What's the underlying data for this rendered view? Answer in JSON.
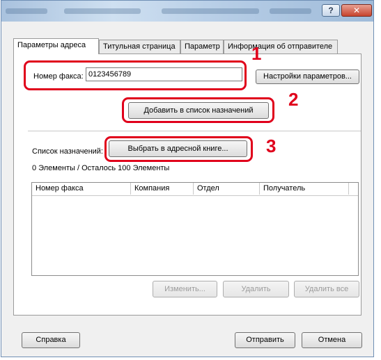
{
  "window": {
    "help_glyph": "?",
    "close_glyph": "✕"
  },
  "tabs": [
    {
      "label": "Параметры адреса"
    },
    {
      "label": "Титульная страница"
    },
    {
      "label": "Параметр"
    },
    {
      "label": "Информация об отправителе"
    }
  ],
  "fax": {
    "label": "Номер факса:",
    "value": "0123456789",
    "settings_button": "Настройки параметров..."
  },
  "add_button": "Добавить в список назначений",
  "destinations": {
    "label": "Список назначений:",
    "address_book_button": "Выбрать в адресной книге...",
    "count_text": "0 Элементы / Осталось 100 Элементы",
    "columns": [
      "Номер факса",
      "Компания",
      "Отдел",
      "Получатель"
    ],
    "rows": []
  },
  "list_buttons": {
    "edit": "Изменить...",
    "delete": "Удалить",
    "delete_all": "Удалить все"
  },
  "footer": {
    "help": "Справка",
    "send": "Отправить",
    "cancel": "Отмена"
  },
  "callouts": {
    "one": "1",
    "two": "2",
    "three": "3",
    "color": "#e0001b"
  }
}
